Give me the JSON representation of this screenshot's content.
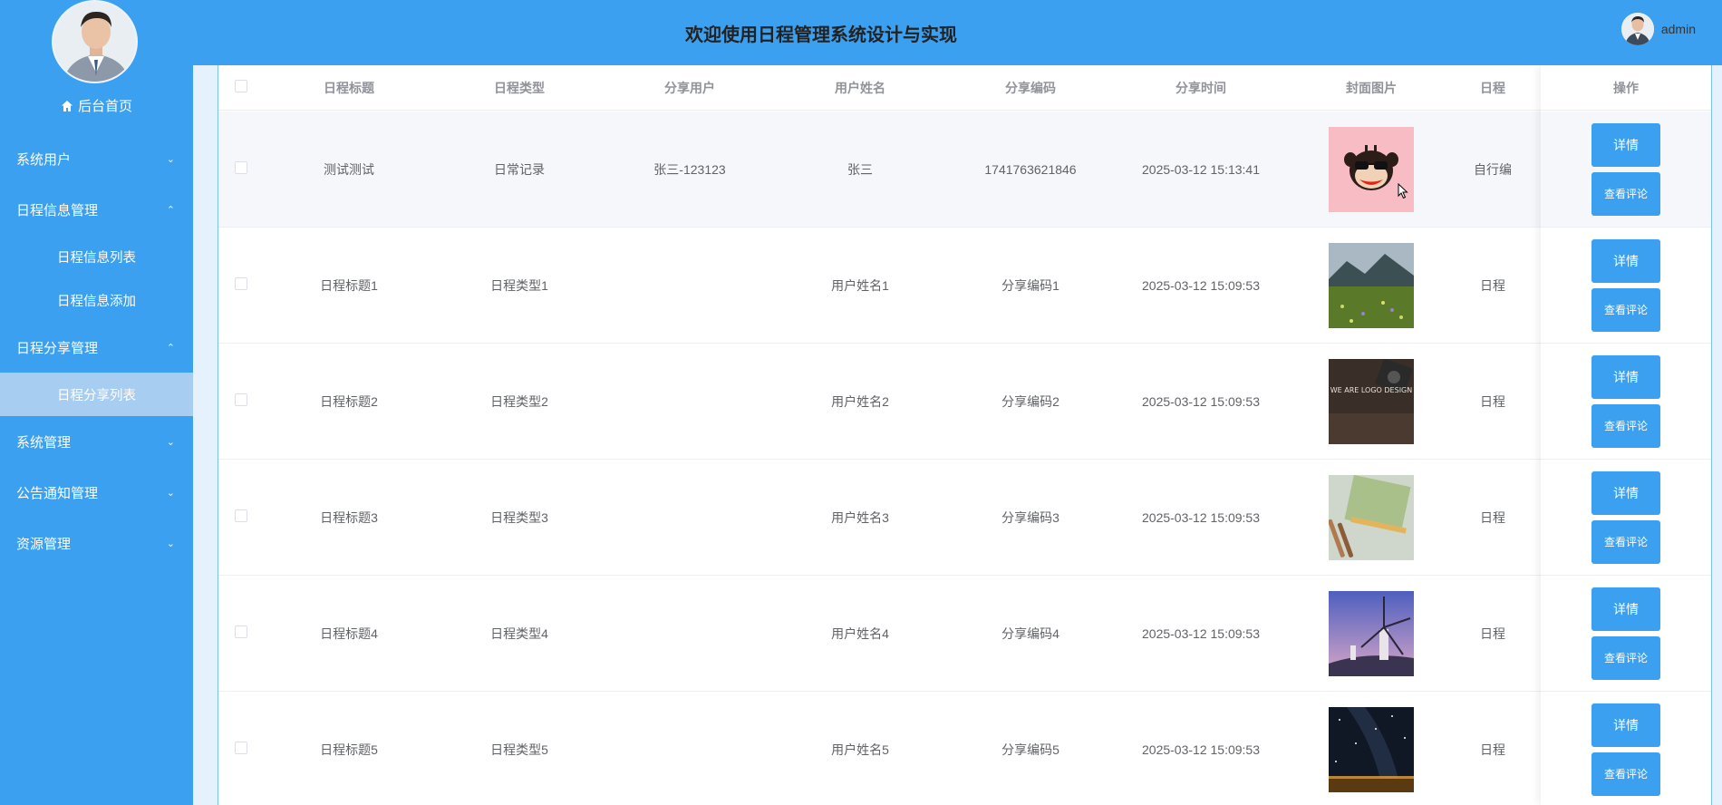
{
  "header": {
    "title": "欢迎使用日程管理系统设计与实现",
    "username": "admin"
  },
  "sidebar": {
    "home": "后台首页",
    "menu": [
      {
        "label": "系统用户",
        "expanded": false
      },
      {
        "label": "日程信息管理",
        "expanded": true,
        "children": [
          "日程信息列表",
          "日程信息添加"
        ]
      },
      {
        "label": "日程分享管理",
        "expanded": true,
        "children": [
          "日程分享列表"
        ]
      },
      {
        "label": "系统管理",
        "expanded": false
      },
      {
        "label": "公告通知管理",
        "expanded": false
      },
      {
        "label": "资源管理",
        "expanded": false
      }
    ]
  },
  "table": {
    "columns": [
      "日程标题",
      "日程类型",
      "分享用户",
      "用户姓名",
      "分享编码",
      "分享时间",
      "封面图片",
      "日程",
      "操作"
    ],
    "rows": [
      {
        "title": "测试测试",
        "type": "日常记录",
        "user": "张三-123123",
        "name": "张三",
        "code": "1741763621846",
        "time": "2025-03-12 15:13:41",
        "extra": "自行编",
        "image": "monkey"
      },
      {
        "title": "日程标题1",
        "type": "日程类型1",
        "user": "",
        "name": "用户姓名1",
        "code": "分享编码1",
        "time": "2025-03-12 15:09:53",
        "extra": "日程",
        "image": "mountain"
      },
      {
        "title": "日程标题2",
        "type": "日程类型2",
        "user": "",
        "name": "用户姓名2",
        "code": "分享编码2",
        "time": "2025-03-12 15:09:53",
        "extra": "日程",
        "image": "design"
      },
      {
        "title": "日程标题3",
        "type": "日程类型3",
        "user": "",
        "name": "用户姓名3",
        "code": "分享编码3",
        "time": "2025-03-12 15:09:53",
        "extra": "日程",
        "image": "notebook"
      },
      {
        "title": "日程标题4",
        "type": "日程类型4",
        "user": "",
        "name": "用户姓名4",
        "code": "分享编码4",
        "time": "2025-03-12 15:09:53",
        "extra": "日程",
        "image": "windmill"
      },
      {
        "title": "日程标题5",
        "type": "日程类型5",
        "user": "",
        "name": "用户姓名5",
        "code": "分享编码5",
        "time": "2025-03-12 15:09:53",
        "extra": "日程",
        "image": "stars"
      }
    ],
    "actions": {
      "detail": "详情",
      "comments": "查看评论"
    }
  },
  "thumb_texts": {
    "design": "WE ARE LOGO DESIGN"
  },
  "colors": {
    "primary": "#3ba0f0",
    "active_submenu": "#a7cdf0",
    "content_bg": "#e5f1fc"
  }
}
